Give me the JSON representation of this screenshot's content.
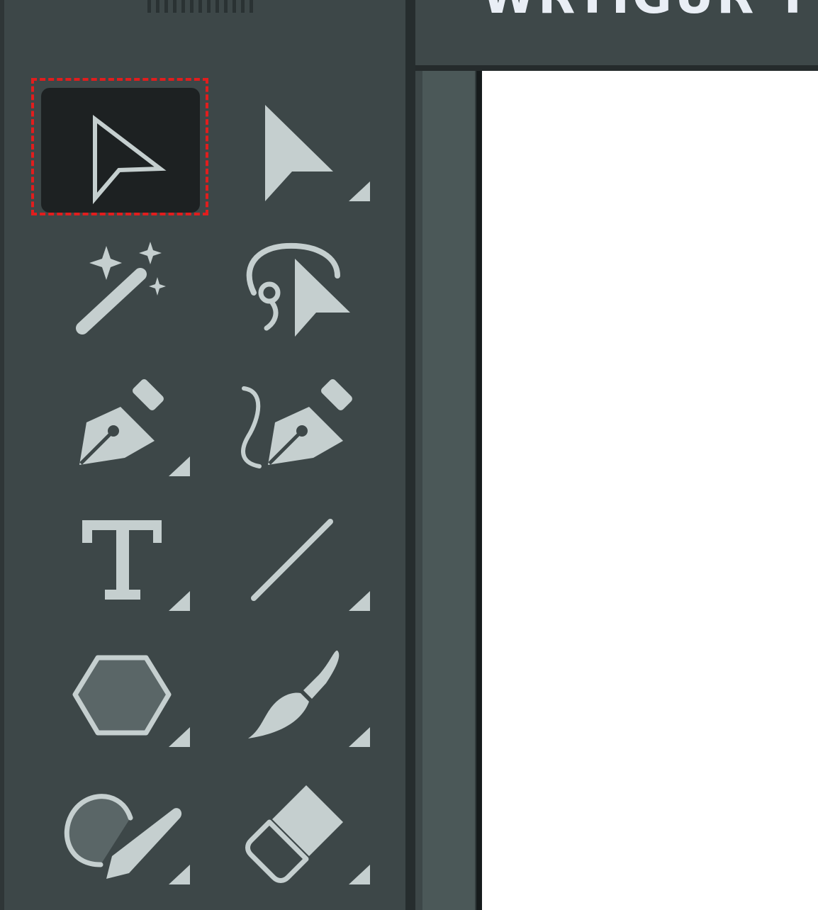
{
  "window": {
    "document_title": "WRTIGUR TT"
  },
  "colors": {
    "panel": "#3d4748",
    "icon": "#c5cfcf",
    "selected_bg": "#1d2122",
    "focus_ring": "#e11d1d",
    "canvas": "#ffffff"
  },
  "tools": [
    {
      "name": "selection-tool",
      "icon": "selection-arrow-icon",
      "selected": true
    },
    {
      "name": "direct-selection-tool",
      "icon": "direct-selection-icon",
      "flyout": true
    },
    {
      "name": "magic-wand-tool",
      "icon": "magic-wand-icon"
    },
    {
      "name": "lasso-tool",
      "icon": "lasso-icon"
    },
    {
      "name": "pen-tool",
      "icon": "pen-icon",
      "flyout": true
    },
    {
      "name": "curvature-tool",
      "icon": "curvature-pen-icon"
    },
    {
      "name": "type-tool",
      "icon": "type-icon",
      "flyout": true
    },
    {
      "name": "line-segment-tool",
      "icon": "line-segment-icon",
      "flyout": true
    },
    {
      "name": "polygon-tool",
      "icon": "polygon-icon",
      "flyout": true
    },
    {
      "name": "paintbrush-tool",
      "icon": "paintbrush-icon",
      "flyout": true
    },
    {
      "name": "shaper-tool",
      "icon": "shaper-icon",
      "flyout": true
    },
    {
      "name": "eraser-tool",
      "icon": "eraser-icon",
      "flyout": true
    }
  ]
}
